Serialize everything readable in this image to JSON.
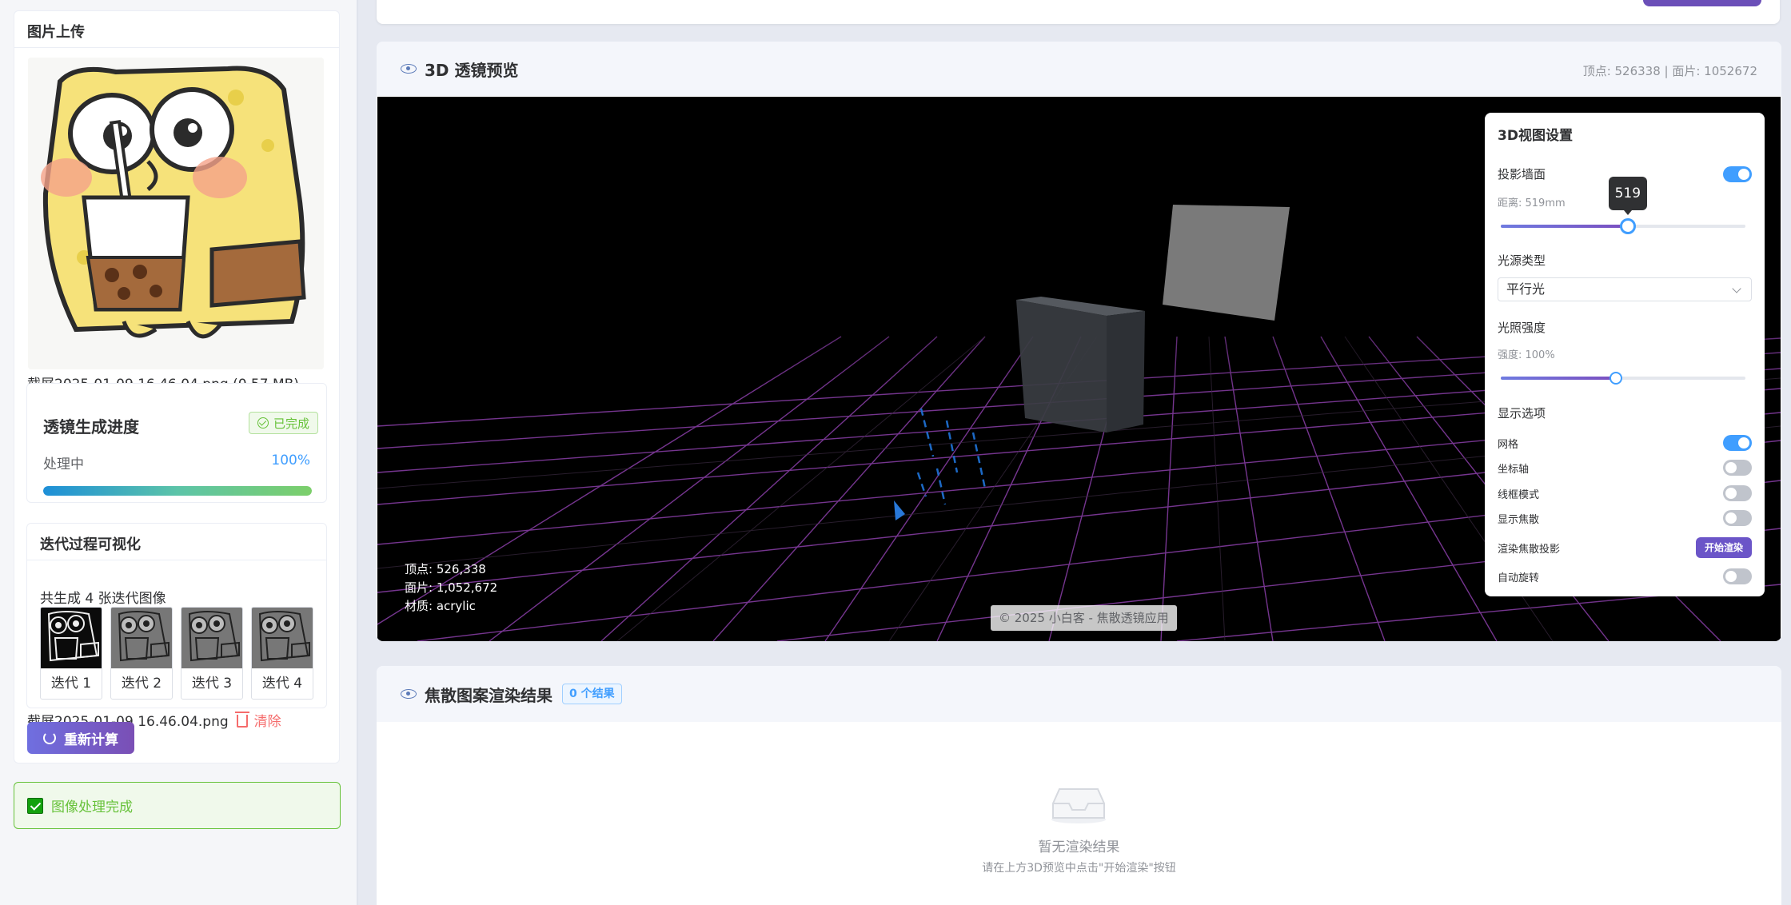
{
  "sidebar": {
    "upload_title": "图片上传",
    "filename": "截屏2025-01-09 16.46.04.png (0.57 MB)",
    "progress": {
      "title": "透镜生成进度",
      "status_tag": "已完成",
      "label": "处理中",
      "percent_text": "100%",
      "value": 1.0
    },
    "iterations": {
      "title": "迭代过程可视化",
      "count_text": "共生成 4 张迭代图像",
      "items": [
        {
          "label": "迭代 1"
        },
        {
          "label": "迭代 2"
        },
        {
          "label": "迭代 3"
        },
        {
          "label": "迭代 4"
        }
      ]
    },
    "file_name": "截屏2025-01-09 16.46.04.png",
    "clear_label": "清除",
    "recalc_label": "重新计算",
    "success_text": "图像处理完成"
  },
  "preview": {
    "title": "3D 透镜预览",
    "stats": "顶点: 526338 | 面片: 1052672",
    "info": {
      "vertices": "顶点: 526,338",
      "faces": "面片: 1,052,672",
      "material": "材质: acrylic"
    },
    "copyright": "© 2025 小白客 - 焦散透镜应用"
  },
  "settings": {
    "title": "3D视图设置",
    "wall": {
      "label": "投影墙面",
      "on": true,
      "distance_text": "距离: 519mm",
      "slider_value": 519,
      "slider_max": 1000,
      "tooltip": "519"
    },
    "light_type": {
      "label": "光源类型",
      "value": "平行光"
    },
    "intensity": {
      "label": "光照强度",
      "value_text": "强度: 100%",
      "slider_fraction": 0.47
    },
    "display": {
      "label": "显示选项",
      "options": [
        {
          "label": "网格",
          "on": true
        },
        {
          "label": "坐标轴",
          "on": false
        },
        {
          "label": "线框模式",
          "on": false
        },
        {
          "label": "显示焦散",
          "on": false
        }
      ]
    },
    "render": {
      "label": "渲染焦散投影",
      "button": "开始渲染"
    },
    "auto_rotate": {
      "label": "自动旋转",
      "on": false
    }
  },
  "results": {
    "title": "焦散图案渲染结果",
    "count_tag": "0 个结果",
    "empty_title": "暂无渲染结果",
    "empty_sub": "请在上方3D预览中点击\"开始渲染\"按钮"
  },
  "colors": {
    "accent": "#409eff",
    "success": "#67c23a",
    "danger": "#f56c6c",
    "purple": "#6b55c8"
  }
}
